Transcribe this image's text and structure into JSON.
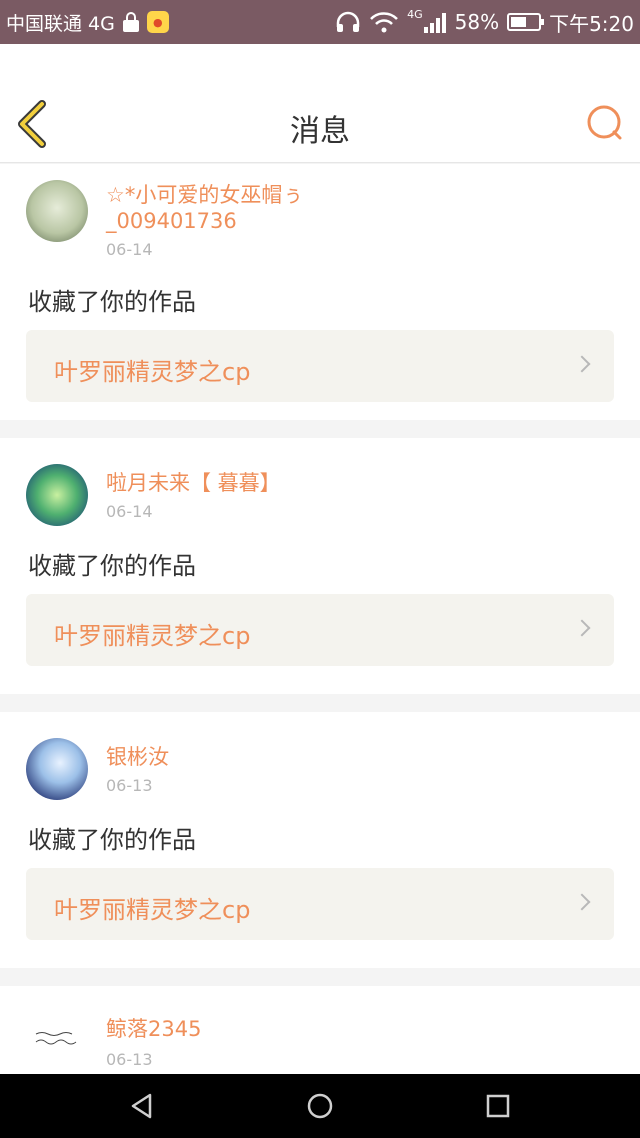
{
  "status_bar": {
    "carrier": "中国联通 4G",
    "network": "4G",
    "battery": "58%",
    "battery_level": 0.58,
    "time": "下午5:20"
  },
  "header": {
    "title": "消息",
    "back_icon": "back-chevron-icon",
    "search_icon": "search-icon",
    "accent_color": "#ef8f5a"
  },
  "messages": [
    {
      "user": "☆*小可爱的女巫帽ぅ_009401736",
      "date": "06-14",
      "action": "收藏了你的作品",
      "work": "叶罗丽精灵梦之cp"
    },
    {
      "user": "啦月未来【 暮暮】",
      "date": "06-14",
      "action": "收藏了你的作品",
      "work": "叶罗丽精灵梦之cp"
    },
    {
      "user": "银彬汝",
      "date": "06-13",
      "action": "收藏了你的作品",
      "work": "叶罗丽精灵梦之cp"
    },
    {
      "user": "鲸落2345",
      "date": "06-13"
    }
  ],
  "nav": {
    "back": "triangle-back-icon",
    "home": "circle-home-icon",
    "recents": "square-recents-icon"
  }
}
